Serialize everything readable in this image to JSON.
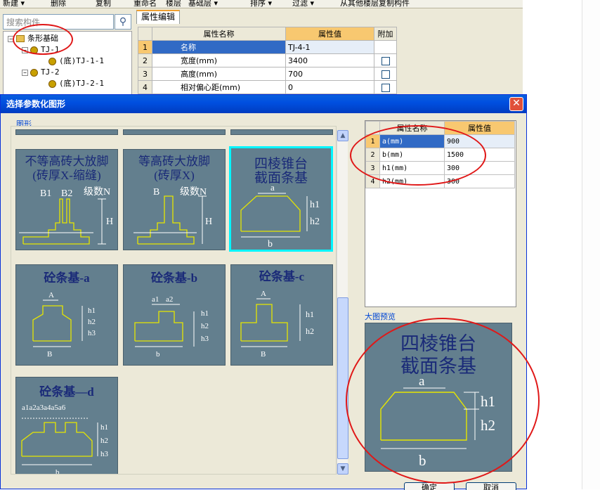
{
  "toolbar": {
    "new": "新建",
    "delete": "删除",
    "copy": "复制",
    "rename": "重命名",
    "floor_label": "楼层",
    "floor_value": "基础层",
    "sort": "排序",
    "filter": "过滤",
    "copy_from": "从其他楼层复制构件"
  },
  "search": {
    "placeholder": "搜索构件..."
  },
  "tree": {
    "root": "条形基础",
    "items": [
      {
        "label": "TJ-1",
        "child": "(底)TJ-1-1"
      },
      {
        "label": "TJ-2",
        "child": "(底)TJ-2-1"
      }
    ]
  },
  "prop_panel": {
    "tab": "属性编辑",
    "headers": [
      "属性名称",
      "属性值",
      "附加"
    ],
    "rows": [
      {
        "num": "1",
        "name": "名称",
        "value": "TJ-4-1"
      },
      {
        "num": "2",
        "name": "宽度(mm)",
        "value": "3400"
      },
      {
        "num": "3",
        "name": "高度(mm)",
        "value": "700"
      },
      {
        "num": "4",
        "name": "相对偏心距(mm)",
        "value": "0"
      }
    ]
  },
  "dialog": {
    "title": "选择参数化图形",
    "close_glyph": "✕",
    "group_label": "图形",
    "preview_label": "大图预览",
    "ok": "确定",
    "cancel": "取消"
  },
  "shapes": [
    {
      "line1": "不等高砖大放脚",
      "line2": "(砖厚X-缩缝)",
      "labels": [
        "B1",
        "B2",
        "级数N",
        "H"
      ]
    },
    {
      "line1": "等高砖大放脚",
      "line2": "(砖厚X)",
      "labels": [
        "B",
        "级数N",
        "H"
      ]
    },
    {
      "line1": "四棱锥台",
      "line2": "截面条基",
      "labels": [
        "a",
        "h1",
        "h2",
        "b"
      ]
    },
    {
      "line1": "砼条基-a",
      "labels": [
        "A",
        "h1",
        "h2",
        "h3",
        "B"
      ]
    },
    {
      "line1": "砼条基-b",
      "labels": [
        "a1",
        "a2",
        "h1",
        "h2",
        "h3",
        "b"
      ]
    },
    {
      "line1": "砼条基-c",
      "labels": [
        "A",
        "h1",
        "h2",
        "B"
      ]
    },
    {
      "line1": "砼条基—d",
      "labels": [
        "a1a2a3a4a5a6",
        "h1",
        "h2",
        "h3",
        "b"
      ]
    }
  ],
  "param_table": {
    "headers": [
      "属性名称",
      "属性值"
    ],
    "rows": [
      {
        "num": "1",
        "name": "a(mm)",
        "value": "900"
      },
      {
        "num": "2",
        "name": "b(mm)",
        "value": "1500"
      },
      {
        "num": "3",
        "name": "h1(mm)",
        "value": "300"
      },
      {
        "num": "4",
        "name": "h2(mm)",
        "value": "300"
      }
    ]
  },
  "preview": {
    "line1": "四棱锥台",
    "line2": "截面条基",
    "labels": [
      "a",
      "h1",
      "h2",
      "b"
    ]
  },
  "colors": {
    "tile_bg": "#637f8e",
    "title_text": "#1a2a78",
    "label_text": "#ffffff",
    "outline": "#e6e600",
    "selection": "#00f5ff",
    "annotation": "#e01818",
    "header_value": "#f8c870",
    "selected_row": "#316ac5"
  }
}
